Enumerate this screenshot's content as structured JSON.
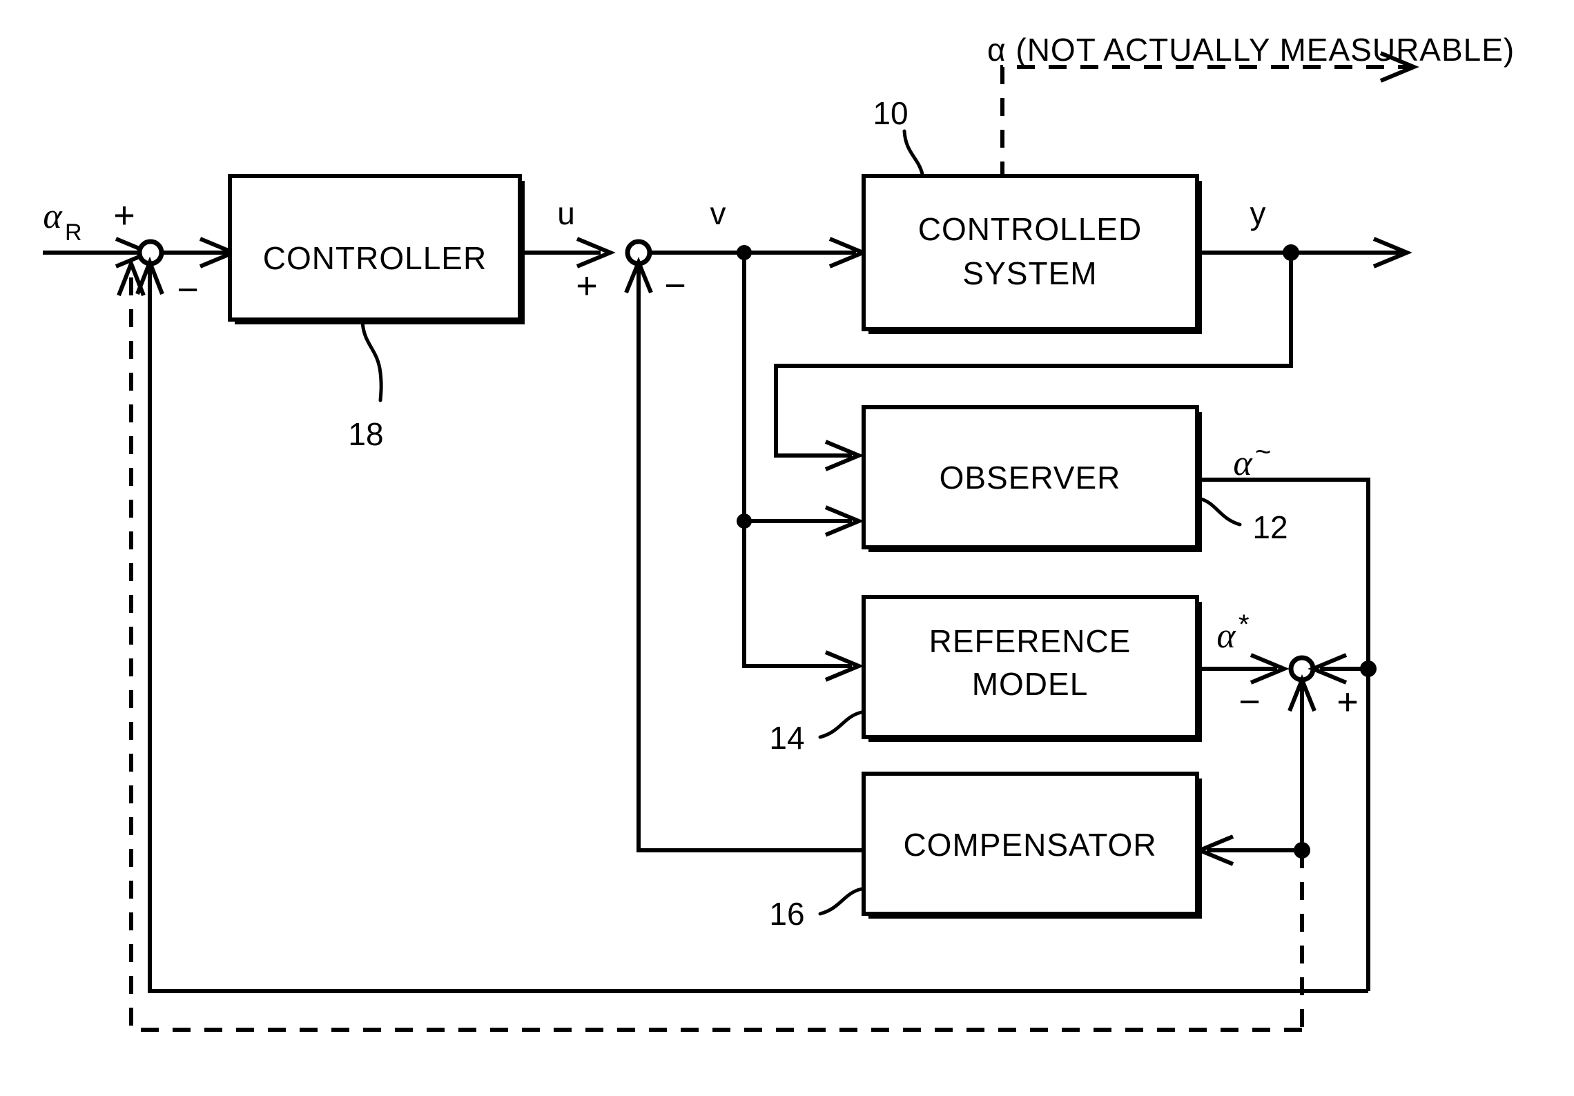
{
  "diagram": {
    "title": "Model-reference adaptive control block diagram",
    "ink_color": "#000000",
    "background_color": "#ffffff",
    "blocks": [
      {
        "id": "controller",
        "label": "CONTROLLER",
        "ref": "18"
      },
      {
        "id": "controlled_system",
        "label_line1": "CONTROLLED",
        "label_line2": "SYSTEM",
        "ref": "10"
      },
      {
        "id": "observer",
        "label": "OBSERVER",
        "ref": "12"
      },
      {
        "id": "reference_model",
        "label_line1": "REFERENCE",
        "label_line2": "MODEL",
        "ref": "14"
      },
      {
        "id": "compensator",
        "label": "COMPENSATOR",
        "ref": "16"
      }
    ],
    "signals": {
      "alpha_r_base": "α",
      "alpha_r_sub": "R",
      "u": "u",
      "v": "v",
      "y": "y",
      "alpha_tilde_base": "α",
      "alpha_tilde_sup": "~",
      "alpha_star_base": "α",
      "alpha_star_sup": "*",
      "alpha_out": "α"
    },
    "annotations": {
      "not_measurable": "α (NOT ACTUALLY MEASURABLE)",
      "not_measurable_alpha": "α",
      "not_measurable_text": "(NOT ACTUALLY MEASURABLE)"
    },
    "signs": {
      "sum1_plus": "+",
      "sum1_minus": "−",
      "sum2_plus": "+",
      "sum2_minus": "−",
      "sum3_plus": "+",
      "sum3_minus": "−"
    },
    "reference_numerals": [
      "10",
      "12",
      "14",
      "16",
      "18"
    ]
  }
}
